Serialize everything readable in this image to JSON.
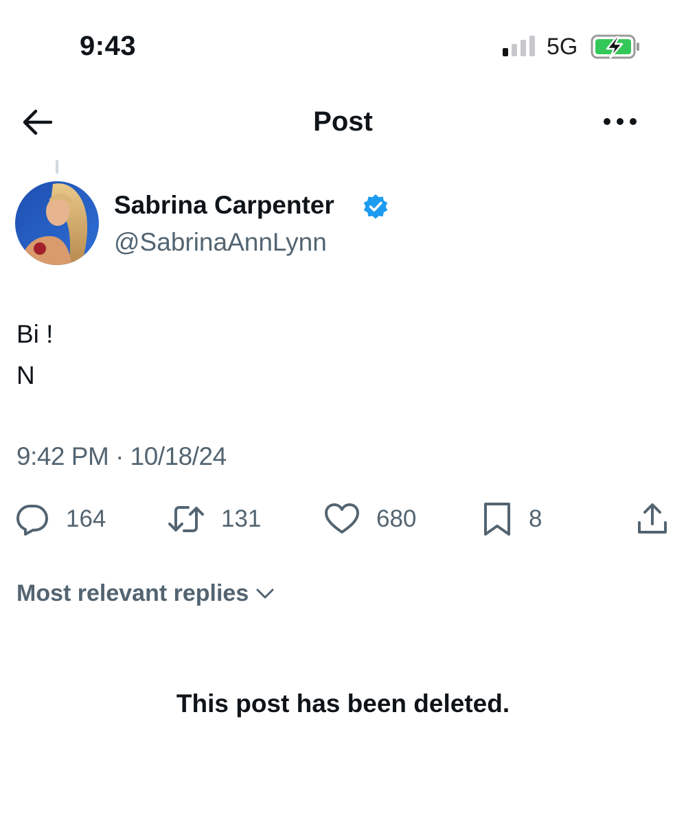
{
  "status_bar": {
    "time": "9:43",
    "network": "5G",
    "icons": [
      "signal-icon",
      "battery-charging-icon"
    ],
    "battery_color": "#34c759"
  },
  "header": {
    "title": "Post",
    "icons": [
      "back-arrow-icon",
      "more-options-icon"
    ]
  },
  "post": {
    "author": {
      "name": "Sabrina Carpenter",
      "handle": "@SabrinaAnnLynn",
      "verified": true,
      "verified_color": "#1d9bf0"
    },
    "text_lines": [
      "Bi !",
      "N"
    ],
    "timestamp": "9:42 PM · 10/18/24",
    "actions": {
      "replies": "164",
      "reposts": "131",
      "likes": "680",
      "bookmarks": "8",
      "icons": [
        "reply-icon",
        "repost-icon",
        "like-icon",
        "bookmark-icon",
        "share-icon"
      ]
    }
  },
  "replies": {
    "sort_label": "Most relevant replies",
    "deleted_notice": "This post has been deleted."
  },
  "colors": {
    "text_primary": "#0f1419",
    "text_secondary": "#536471",
    "accent": "#1d9bf0"
  }
}
